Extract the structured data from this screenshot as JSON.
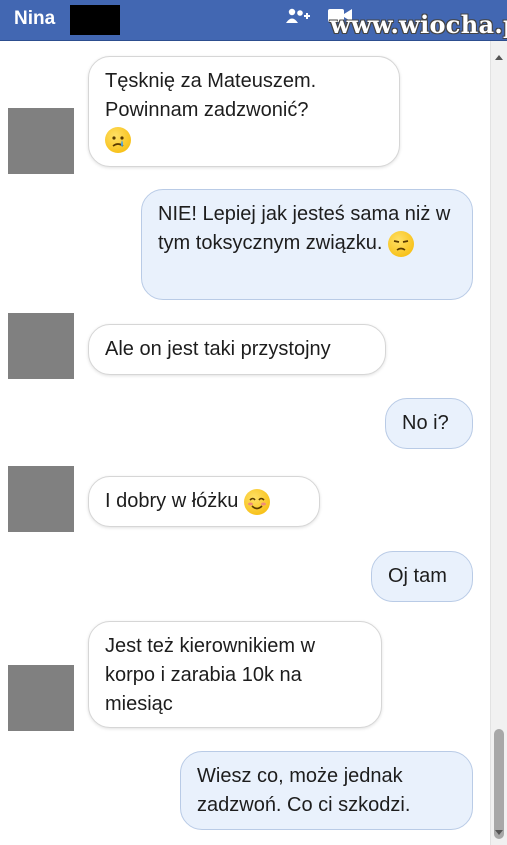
{
  "header": {
    "contact_name": "Nina",
    "watermark": "www.wiocha.pl",
    "add_icon": "+"
  },
  "icons": {
    "add_people": "add-people-icon",
    "video": "video-icon"
  },
  "colors": {
    "header_bg": "#4267b2",
    "outgoing_bubble": "#e9f1fc",
    "avatar": "#808080"
  },
  "messages": [
    {
      "direction": "in",
      "text": "Tęsknię za Mateuszem. Powinnam zadzwonić?",
      "emoji": "crying-face"
    },
    {
      "direction": "out",
      "text": "NIE! Lepiej jak jesteś sama niż w tym toksycznym związku.",
      "emoji": "unamused-face"
    },
    {
      "direction": "in",
      "text": "Ale on jest taki przystojny"
    },
    {
      "direction": "out",
      "text": "No i?"
    },
    {
      "direction": "in",
      "text": "I dobry w łóżku",
      "emoji": "smiling-face"
    },
    {
      "direction": "out",
      "text": "Oj tam"
    },
    {
      "direction": "in",
      "text": "Jest też kierownikiem w korpo i zarabia 10k na miesiąc"
    },
    {
      "direction": "out",
      "text": "Wiesz co, może jednak zadzwoń. Co ci szkodzi."
    }
  ]
}
